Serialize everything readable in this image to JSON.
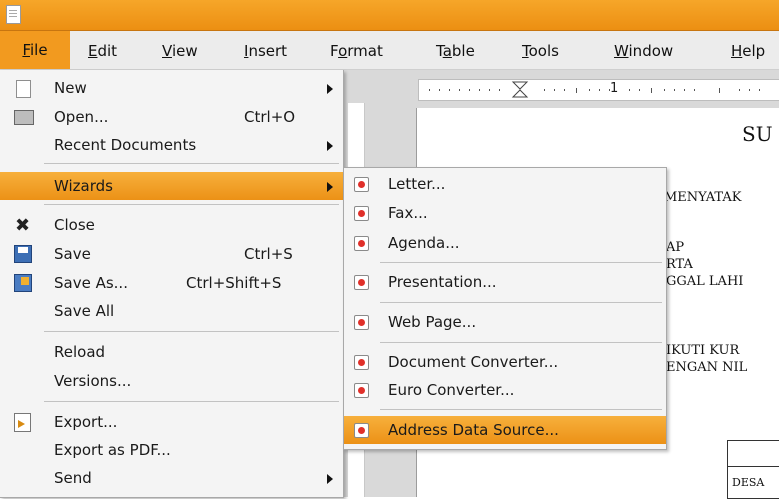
{
  "menubar": {
    "items": [
      "File",
      "Edit",
      "View",
      "Insert",
      "Format",
      "Table",
      "Tools",
      "Window",
      "Help"
    ]
  },
  "file_menu": {
    "new": "New",
    "open": "Open...",
    "open_shortcut": "Ctrl+O",
    "recent": "Recent Documents",
    "wizards": "Wizards",
    "close": "Close",
    "save": "Save",
    "save_shortcut": "Ctrl+S",
    "save_as": "Save As...",
    "save_as_shortcut": "Ctrl+Shift+S",
    "save_all": "Save All",
    "reload": "Reload",
    "versions": "Versions...",
    "export": "Export...",
    "export_pdf": "Export as PDF...",
    "send": "Send"
  },
  "wizards_menu": {
    "letter": "Letter...",
    "fax": "Fax...",
    "agenda": "Agenda...",
    "presentation": "Presentation...",
    "web_page": "Web Page...",
    "document_converter": "Document Converter...",
    "euro_converter": "Euro Converter...",
    "address_data_source": "Address Data Source..."
  },
  "ruler": {
    "mark": "1"
  },
  "document": {
    "heading": "SU",
    "line1": "MENYATAK",
    "line2": "AP",
    "line3": "RTA",
    "line4": "GGAL LAHI",
    "line5": "IKUTI KUR",
    "line6": "ENGAN NIL",
    "line7": "DESA"
  },
  "colors": {
    "accent": "#f29a1f",
    "menu_bg": "#f4f4f4"
  }
}
